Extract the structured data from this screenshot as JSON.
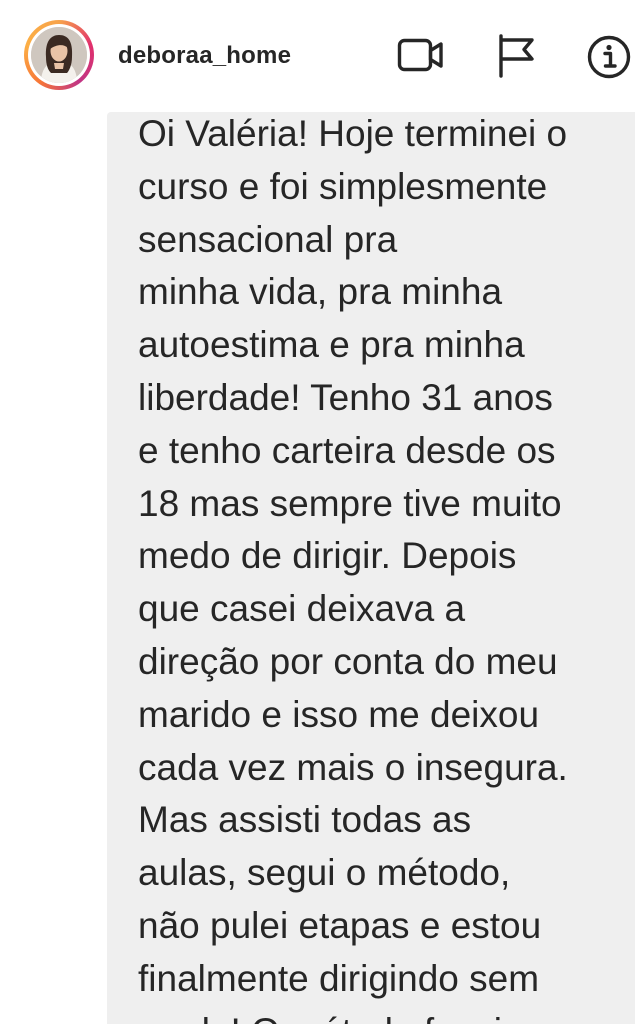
{
  "header": {
    "username": "deboraa_home",
    "icons": [
      "video-call-icon",
      "flag-icon",
      "info-icon"
    ]
  },
  "message": {
    "lines": [
      "Oi Valéria! Hoje terminei o",
      "curso e foi simplesmente",
      "sensacional pra",
      "minha vida, pra minha",
      "autoestima e pra minha",
      "liberdade! Tenho 31 anos",
      "e tenho carteira desde os",
      "18 mas sempre tive muito",
      "medo de dirigir. Depois",
      "que casei deixava a",
      "direção por conta do meu",
      "marido e isso me deixou",
      "cada vez mais o insegura.",
      "Mas assisti todas as",
      "aulas, segui o método,",
      "não pulei etapas e estou",
      "finalmente dirigindo sem",
      "medo! O método funciona"
    ]
  },
  "colors": {
    "text": "#262626",
    "bubble": "#efefef",
    "story_ring_start": "#fcaf45",
    "story_ring_end": "#c13584"
  }
}
